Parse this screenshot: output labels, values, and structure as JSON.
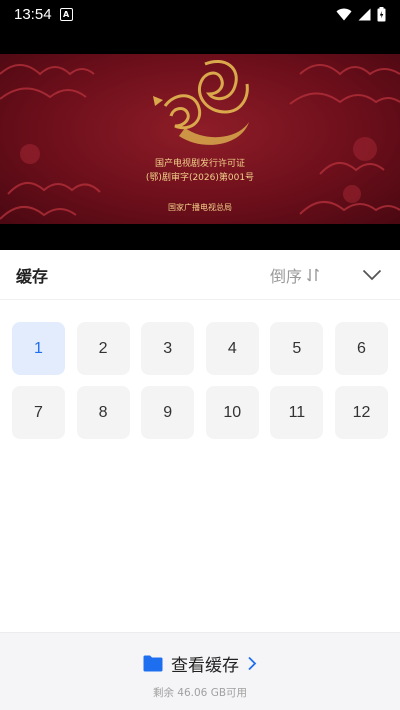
{
  "status_bar": {
    "time": "13:54",
    "app_icon": "A"
  },
  "video": {
    "license_line1": "国产电视剧发行许可证",
    "license_line2": "(鄂)剧审字(2026)第001号",
    "issuer": "国家广播电视总局"
  },
  "episodes": {
    "title": "缓存",
    "sort_label": "倒序",
    "selected": "1",
    "items": [
      "1",
      "2",
      "3",
      "4",
      "5",
      "6",
      "7",
      "8",
      "9",
      "10",
      "11",
      "12"
    ]
  },
  "bottom": {
    "view_cache_label": "查看缓存",
    "storage_text": "剩余 46.06 GB可用"
  },
  "colors": {
    "accent": "#1e6ff0",
    "selected_bg": "#e3ecfd",
    "video_red": "#7a1220",
    "gold": "#d9a94c"
  }
}
